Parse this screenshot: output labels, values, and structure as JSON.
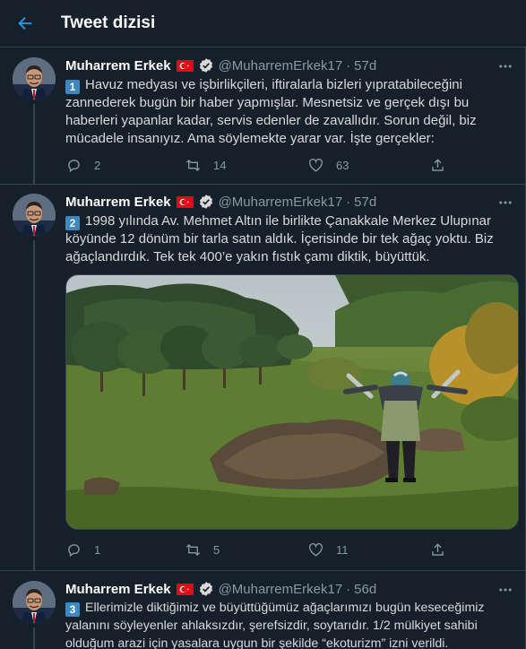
{
  "header": {
    "title": "Tweet dizisi"
  },
  "icons": {
    "back": "arrow-left-icon",
    "more": "more-horizontal-icon",
    "reply": "reply-icon",
    "retweet": "retweet-icon",
    "like": "heart-icon",
    "share": "share-icon",
    "verified": "verified-badge-icon",
    "flag": "turkish-flag-icon"
  },
  "colors": {
    "background": "#15202b",
    "accent": "#1da1f2",
    "muted": "#8899a6",
    "divider": "#38444d",
    "flag": "#e30a17"
  },
  "tweets": [
    {
      "name": "Muharrem Erkek",
      "handle": "@MuharremErkek17",
      "dot": "·",
      "time": "57d",
      "number": "1",
      "text": "Havuz medyası ve işbirlikçileri, iftiralarla bizleri yıpratabileceğini zannederek bugün bir haber yapmışlar. Mesnetsiz ve gerçek dışı bu haberleri yapanlar kadar, servis edenler de zavallıdır. Sorun değil, biz mücadele insanıyız. Ama söylemekte yarar var. İşte gerçekler:",
      "replies": "2",
      "retweets": "14",
      "likes": "63"
    },
    {
      "name": "Muharrem Erkek",
      "handle": "@MuharremErkek17",
      "dot": "·",
      "time": "57d",
      "number": "2",
      "text": "1998 yılında Av. Mehmet Altın ile birlikte Çanakkale Merkez Ulupınar köyünde 12 dönüm bir tarla satın aldık. İçerisinde bir tek ağaç yoktu. Biz ağaçlandırdık. Tek tek 400’e yakın fıstık çamı diktik, büyüttük.",
      "replies": "1",
      "retweets": "5",
      "likes": "11"
    },
    {
      "name": "Muharrem Erkek",
      "handle": "@MuharremErkek17",
      "dot": "·",
      "time": "56d",
      "number": "3",
      "text": "Ellerimizle diktiğimiz ve büyüttüğümüz ağaçlarımızı bugün keseceğimiz yalanını söyleyenler ahlaksızdır, şerefsizdir, soytarıdır. 1/2 mülkiyet sahibi olduğum arazi için yasalara uygun bir şekilde “ekoturizm” izni verildi."
    }
  ]
}
